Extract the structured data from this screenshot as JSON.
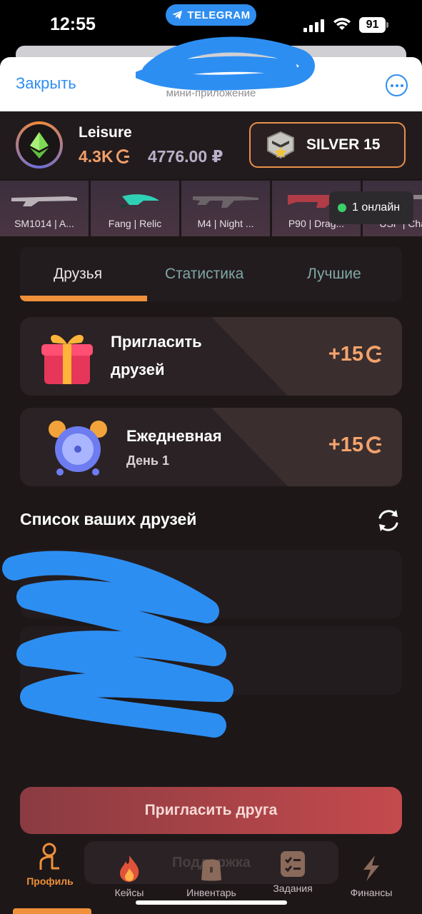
{
  "status_bar": {
    "time": "12:55",
    "pill": "TELEGRAM",
    "battery": "91"
  },
  "header": {
    "close_label": "Закрыть",
    "subtitle": "мини-приложение"
  },
  "profile": {
    "username": "Leisure",
    "coins": "4.3K",
    "balance": "4776.00 ₽",
    "rank": "SILVER 15"
  },
  "items": [
    {
      "name": "SM1014 | A..."
    },
    {
      "name": "Fang | Relic"
    },
    {
      "name": "M4 | Night ..."
    },
    {
      "name": "P90 | Drag..."
    },
    {
      "name": "USP | Cha..."
    }
  ],
  "online": "1 онлайн",
  "tabs": [
    "Друзья",
    "Статистика",
    "Лучшие"
  ],
  "cards": [
    {
      "title_line1": "Пригласить",
      "title_line2": "друзей",
      "reward": "+15"
    },
    {
      "title": "Ежедневная",
      "subtitle": "День 1",
      "reward": "+15"
    }
  ],
  "friends_section": {
    "title": "Список ваших друзей"
  },
  "invite_button": "Пригласить друга",
  "support_button": "Поддержка",
  "nav": [
    {
      "label": "Профиль",
      "icon": "profile-icon",
      "active": true
    },
    {
      "label": "Кейсы",
      "icon": "fire-icon",
      "active": false
    },
    {
      "label": "Инвентарь",
      "icon": "backpack-icon",
      "active": false
    },
    {
      "label": "Задания",
      "icon": "tasks-icon",
      "active": false
    },
    {
      "label": "Финансы",
      "icon": "lightning-icon",
      "active": false
    }
  ],
  "colors": {
    "accent": "#f0903a",
    "telegram_blue": "#2f8ef0",
    "background": "#1d1718",
    "reward": "#f4a46c",
    "scribble": "#2d8ef2"
  }
}
